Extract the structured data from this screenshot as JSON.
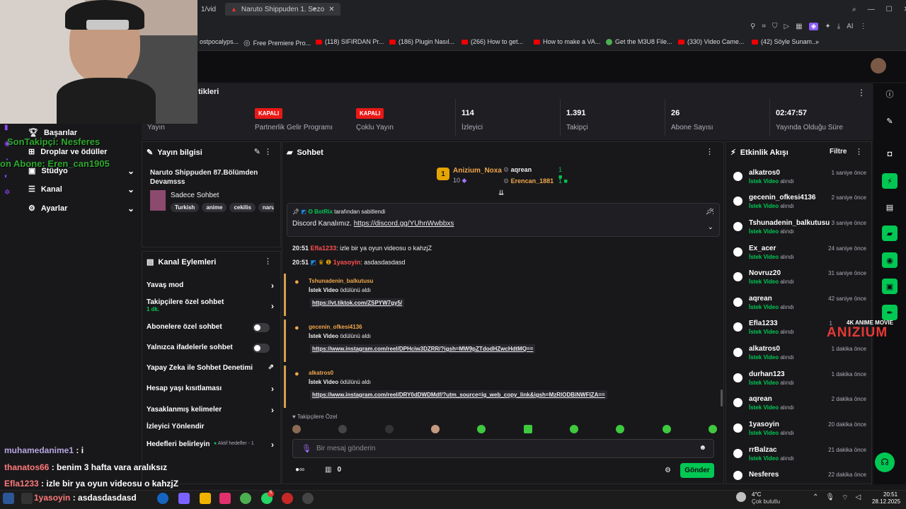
{
  "browser": {
    "tab1_label": "1/vid",
    "tab2_label": "Naruto Shippuden 1. Sezo",
    "bookmarks": [
      "ostpocalyps...",
      "Free Premiere Pro...",
      "(118) SIFIRDAN Pr...",
      "(186) Plugin Nasıl...",
      "(266) How to get...",
      "How to make a VA...",
      "Get the M3U8 File...",
      "(330) Video Came...",
      "(42) Söyle Sunam..."
    ],
    "ai_label": "AI"
  },
  "stats": {
    "title": "tikleri",
    "items": [
      {
        "value": "",
        "label": "Yayın"
      },
      {
        "badge": "KAPALI",
        "label": "Partnerlik Gelir Programı"
      },
      {
        "badge": "KAPALI",
        "label": "Çoklu Yayın"
      },
      {
        "value": "114",
        "label": "İzleyici"
      },
      {
        "value": "1.391",
        "label": "Takipçi"
      },
      {
        "value": "26",
        "label": "Abone Sayısı"
      },
      {
        "value": "02:47:57",
        "label": "Yayında Olduğu Süre"
      }
    ]
  },
  "nav": {
    "items": [
      "Başarılar",
      "Droplar ve ödüller",
      "Stüdyo",
      "Kanal",
      "Ayarlar"
    ]
  },
  "stream_info": {
    "title": "Yayın bilgisi",
    "stream_title": "Naruto Shippuden 87.Bölümden Devamsss",
    "category": "Sadece Sohbet",
    "tags": [
      "Turkish",
      "anime",
      "cekilis",
      "naru"
    ]
  },
  "channel_actions": {
    "title": "Kanal Eylemleri",
    "items": [
      {
        "label": "Yavaş mod"
      },
      {
        "label": "Takipçilere özel sohbet",
        "sub": "1 dk."
      },
      {
        "label": "Abonelere özel sohbet"
      },
      {
        "label": "Yalnızca ifadelerle sohbet"
      },
      {
        "label": "Yapay Zeka ile Sohbet Denetimi"
      },
      {
        "label": "Hesap yaşı kısıtlaması"
      },
      {
        "label": "Yasaklanmış kelimeler"
      },
      {
        "label": "İzleyici Yönlendir"
      },
      {
        "label": "Hedefleri belirleyin",
        "extra": "Aktif hedefler - 1"
      }
    ]
  },
  "chat": {
    "title": "Sohbet",
    "leader1": {
      "rank": "1",
      "name": "Anizium_Noxa",
      "points": "10"
    },
    "leader2a": {
      "name": "aqrean",
      "count": "1"
    },
    "leader2b": {
      "name": "Erencan_1881",
      "count": "1"
    },
    "pinned": {
      "by": "BotRix",
      "by_suffix": "tarafından sabitlendi",
      "text": "Discord Kanalımız.",
      "link": "https://discord.gg/YUhnWwbbxs"
    },
    "messages": [
      {
        "time": "20:51",
        "user": "Efla1233",
        "text": ": izle bir ya oyun videosu o kahzjZ"
      },
      {
        "time": "20:51",
        "user": "1yasoyin",
        "text": ": asdasdasdasd"
      }
    ],
    "rewards": [
      {
        "user": "Tshunadenin_balkutusu",
        "what_b": "İstek Video",
        "what": "ödülünü aldı",
        "link": "https://vt.tiktok.com/ZSPYW7gy5/"
      },
      {
        "user": "gecenin_ofkesi4136",
        "what_b": "İstek Video",
        "what": "ödülünü aldı",
        "link": "https://www.instagram.com/reel/DPHciw3DZRR/?igsh=MW9pZTdodHZwcHdtMQ=="
      },
      {
        "user": "alkatros0",
        "what_b": "İstek Video",
        "what": "ödülünü aldı",
        "link": "https://www.instagram.com/reel/DRY0dDWDMdf/?utm_source=ig_web_copy_link&igsh=MzRlODBiNWFlZA=="
      }
    ],
    "followers_label": "Takipçilere Özel",
    "input_placeholder": "Bir mesaj gönderin",
    "points": "0",
    "send_label": "Gönder"
  },
  "activity": {
    "title": "Etkinlik Akışı",
    "filter_label": "Filtre",
    "items": [
      {
        "name": "alkatros0",
        "time": "1 saniye önce",
        "reward": "İstek Video",
        "action": "alındı"
      },
      {
        "name": "gecenin_ofkesi4136",
        "time": "2 saniye önce",
        "reward": "İstek Video",
        "action": "alındı"
      },
      {
        "name": "Tshunadenin_balkutusu",
        "time": "3 saniye önce",
        "reward": "İstek Video",
        "action": "alındı"
      },
      {
        "name": "Ex_acer",
        "time": "24 saniye önce",
        "reward": "İstek Video",
        "action": "alındı"
      },
      {
        "name": "Novruz20",
        "time": "31 saniye önce",
        "reward": "İstek Video",
        "action": "alındı"
      },
      {
        "name": "aqrean",
        "time": "42 saniye önce",
        "reward": "İstek Video",
        "action": "alındı"
      },
      {
        "name": "Efla1233",
        "time": "1",
        "reward": "İstek Video",
        "action": "alındı"
      },
      {
        "name": "alkatros0",
        "time": "1 dakika önce",
        "reward": "İstek Video",
        "action": "alındı"
      },
      {
        "name": "durhan123",
        "time": "1 dakika önce",
        "reward": "İstek Video",
        "action": "alındı"
      },
      {
        "name": "aqrean",
        "time": "2 dakika önce",
        "reward": "İstek Video",
        "action": "alındı"
      },
      {
        "name": "1yasoyin",
        "time": "20 dakika önce",
        "reward": "İstek Video",
        "action": "alındı"
      },
      {
        "name": "rrBalzac",
        "time": "21 dakika önce",
        "reward": "İstek Video",
        "action": "alındı"
      },
      {
        "name": "Nesferes",
        "time": "22 dakika önce",
        "reward": "",
        "action": ""
      }
    ]
  },
  "overlay": {
    "last_follower": "SonTakipçi: Nesferes",
    "last_sub": "on Abone: Eren_can1905",
    "chat_lines": [
      {
        "user": "muhamedanime1",
        "text": " : i"
      },
      {
        "user": "thanatos66",
        "text": " : benim 3 hafta vara aralıksız"
      },
      {
        "user": "Efla1233",
        "text": " : izle bir ya oyun videosu o kahzjZ"
      },
      {
        "user": "1yasoyin",
        "text": " : asdasdasdasd"
      }
    ],
    "logo_small": "4K ANIME MOVIE",
    "logo_big": "ANIZIUM"
  },
  "taskbar": {
    "weather_temp": "4°C",
    "weather_desc": "Çok bulutlu",
    "time": "20:51",
    "date": "28.12.2025",
    "badge_count": "5"
  },
  "colors": {
    "accent": "#9147ff",
    "green": "#00c853",
    "red": "#e91916",
    "orange": "#f1a74a"
  }
}
